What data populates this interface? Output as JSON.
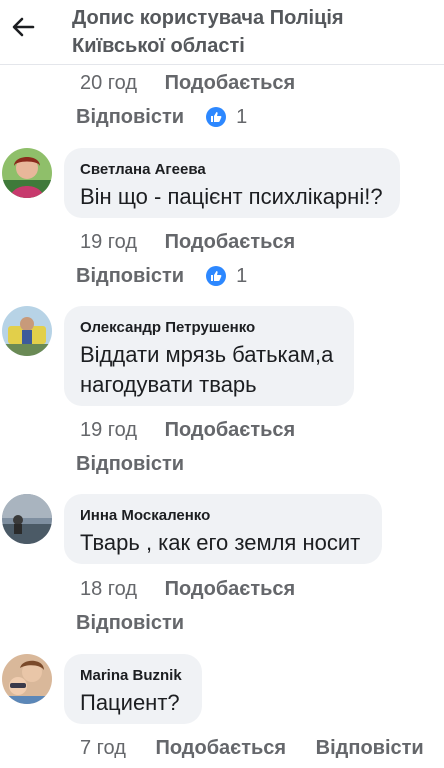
{
  "header": {
    "title": "Допис користувача Поліція Київської області"
  },
  "colors": {
    "like_badge": "#2d88ff",
    "bubble_bg": "#f0f2f5",
    "meta_text": "#65676b"
  },
  "top_meta": {
    "time": "20 год",
    "like_label": "Подобається",
    "reply_label": "Відповісти",
    "like_icon": "thumbs-up-icon",
    "reaction_count": "1"
  },
  "comments": [
    {
      "author": "Светлана Агеева",
      "text": "Він що - пацієнт психлікарні!?",
      "time": "19 год",
      "like_label": "Подобається",
      "reply_label": "Відповісти",
      "reaction_count": "1"
    },
    {
      "author": "Олександр Петрушенко",
      "text_line1": "Віддати мрязь батькам,а",
      "text_line2": "нагодувати тварь",
      "time": "19 год",
      "like_label": "Подобається",
      "reply_label": "Відповісти"
    },
    {
      "author": "Инна Москаленко",
      "text": "Тварь , как его земля носит",
      "time": "18 год",
      "like_label": "Подобається",
      "reply_label": "Відповісти"
    },
    {
      "author": "Marina Buznik",
      "text": "Пациент?",
      "time": "7 год",
      "like_label": "Подобається",
      "reply_label": "Відповісти"
    }
  ]
}
